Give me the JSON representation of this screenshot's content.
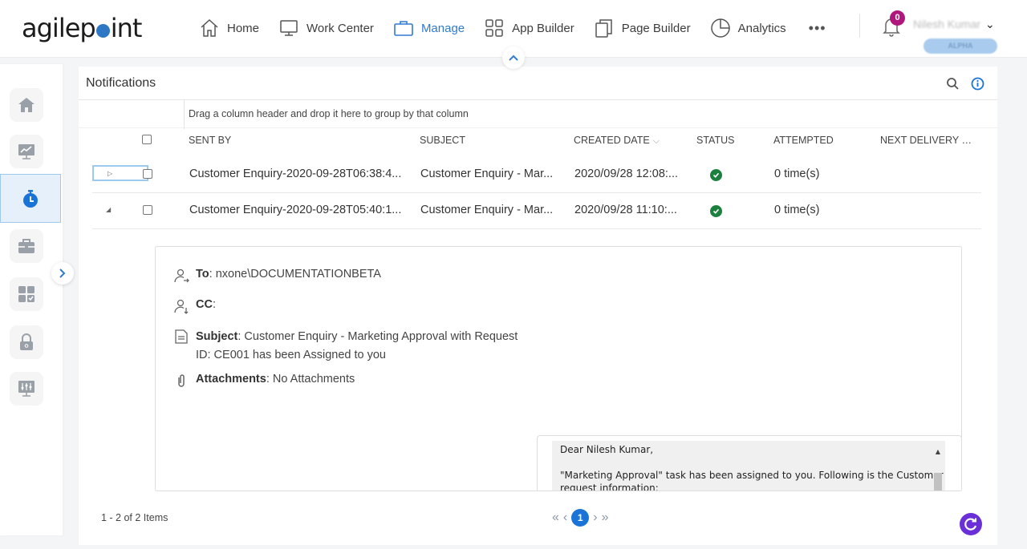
{
  "brand": {
    "logo_text_before": "agilep",
    "logo_text_after": "int"
  },
  "nav": {
    "items": [
      {
        "label": "Home",
        "icon": "home-icon",
        "active": false
      },
      {
        "label": "Work Center",
        "icon": "monitor-icon",
        "active": false
      },
      {
        "label": "Manage",
        "icon": "briefcase-icon",
        "active": true
      },
      {
        "label": "App Builder",
        "icon": "grid-icon",
        "active": false
      },
      {
        "label": "Page Builder",
        "icon": "pages-icon",
        "active": false
      },
      {
        "label": "Analytics",
        "icon": "pie-chart-icon",
        "active": false
      }
    ],
    "more_label": "•••",
    "notification_count": "0",
    "user_name": "Nilesh Kumar",
    "user_chevron": "⌄",
    "environment": "ALPHA",
    "collapse_glyph": "^"
  },
  "sidebar": {
    "items": [
      {
        "name": "home",
        "icon": "home-icon"
      },
      {
        "name": "dashboard",
        "icon": "monitor-chart-icon"
      },
      {
        "name": "timer",
        "icon": "stopwatch-icon",
        "active": true
      },
      {
        "name": "toolbox",
        "icon": "toolbox-icon"
      },
      {
        "name": "apps",
        "icon": "apps-check-icon"
      },
      {
        "name": "security",
        "icon": "lock-icon"
      },
      {
        "name": "settings",
        "icon": "sliders-monitor-icon"
      }
    ],
    "expand_glyph": ">"
  },
  "panel": {
    "title": "Notifications",
    "group_hint": "Drag a column header and drop it here to group by that column",
    "columns": [
      "SENT BY",
      "SUBJECT",
      "CREATED DATE",
      "STATUS",
      "ATTEMPTED",
      "NEXT DELIVERY D..."
    ],
    "sort_indicator": "⌵",
    "rows": [
      {
        "sent_by": "Customer Enquiry-2020-09-28T06:38:4...",
        "subject": "Customer Enquiry - Mar...",
        "created_date": "2020/09/28 12:08:...",
        "status": "success",
        "attempted": "0 time(s)",
        "next_delivery": "",
        "expanded": false,
        "expander_glyph": "▷"
      },
      {
        "sent_by": "Customer Enquiry-2020-09-28T05:40:1...",
        "subject": "Customer Enquiry - Mar...",
        "created_date": "2020/09/28 11:10:...",
        "status": "success",
        "attempted": "0 time(s)",
        "next_delivery": "",
        "expanded": true,
        "expander_glyph": "◢"
      }
    ],
    "detail": {
      "to_label": "To",
      "to_value": ": nxone\\DOCUMENTATIONBETA",
      "cc_label": "CC",
      "cc_value": ":",
      "subject_label": "Subject",
      "subject_value": ": Customer Enquiry - Marketing Approval with Request",
      "subject_value_line2": "ID: CE001 has been Assigned to you",
      "attachments_label": "Attachments",
      "attachments_value": ": No Attachments",
      "message_line1": "Dear Nilesh Kumar,",
      "message_line2": "\"Marketing Approval\" task has been assigned to you. Following is the Customer",
      "message_line3": "request information:",
      "scroll_up_glyph": "▲"
    },
    "footer": {
      "count_text": "1 - 2 of 2 Items",
      "first_glyph": "«",
      "prev_glyph": "‹",
      "current_page": "1",
      "next_glyph": "›",
      "last_glyph": "»"
    }
  },
  "colors": {
    "accent": "#2f7bd0",
    "badge": "#b0177d",
    "success": "#1b7f3e",
    "refresh": "#6a2fd6",
    "page_current": "#1a73d6"
  }
}
